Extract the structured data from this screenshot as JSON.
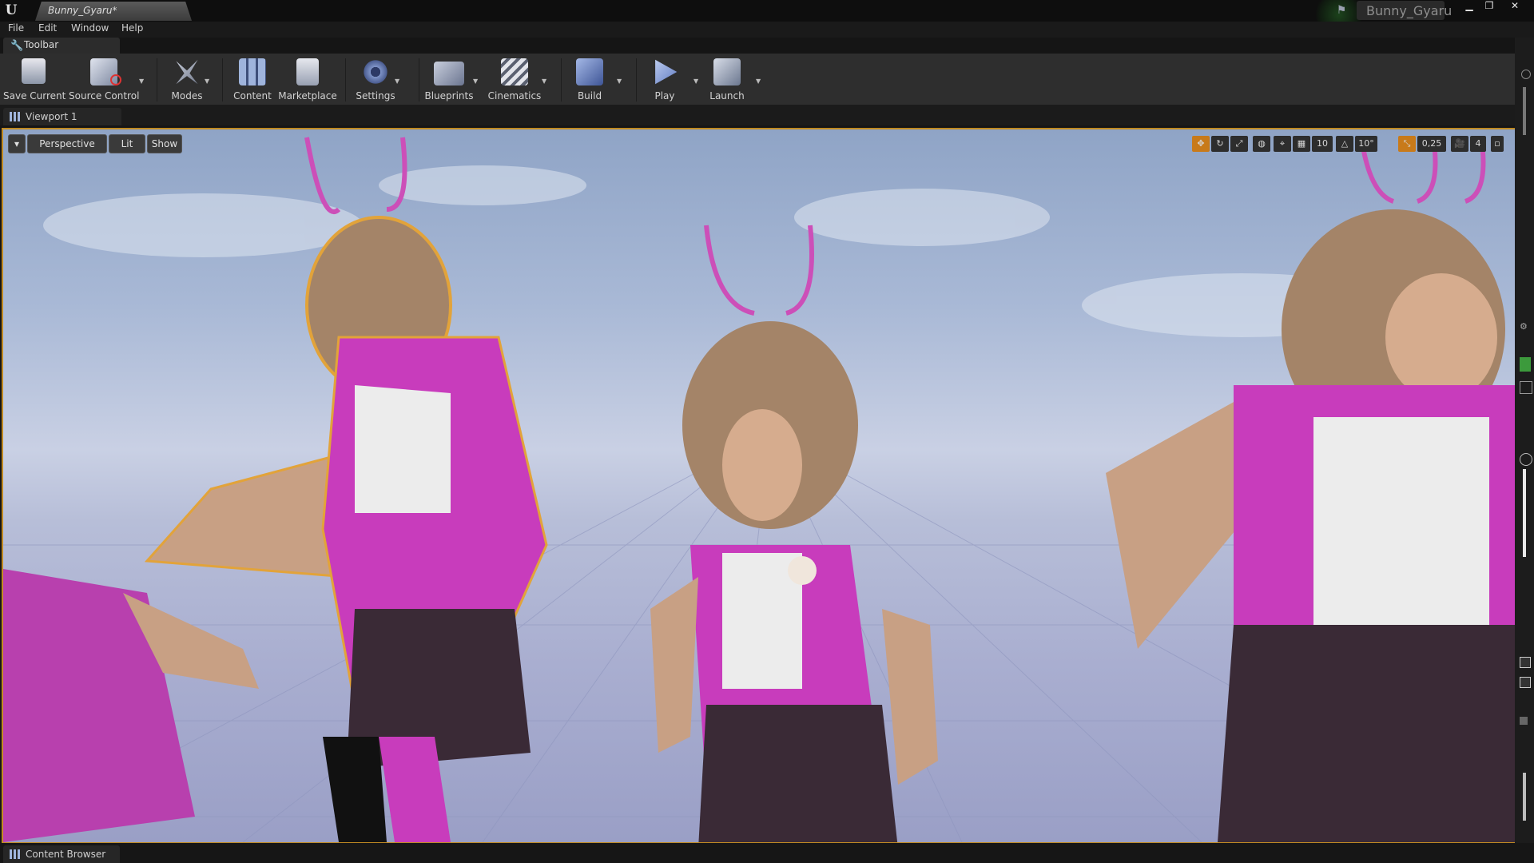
{
  "title_bar": {
    "logo": "U",
    "document_tab": "Bunny_Gyaru*",
    "project_name": "Bunny_Gyaru",
    "icons": [
      "unreal-logo-icon",
      "flag-icon",
      "minimize-icon",
      "restore-icon",
      "close-icon"
    ]
  },
  "menu": {
    "items": [
      "File",
      "Edit",
      "Window",
      "Help"
    ]
  },
  "toolbar_tab": {
    "label": "Toolbar"
  },
  "toolbar": {
    "buttons": [
      {
        "label": "Save Current",
        "icon": "save-icon"
      },
      {
        "label": "Source Control",
        "icon": "source-control-icon"
      },
      {
        "label": "Modes",
        "icon": "modes-icon"
      },
      {
        "label": "Content",
        "icon": "content-icon"
      },
      {
        "label": "Marketplace",
        "icon": "marketplace-icon"
      },
      {
        "label": "Settings",
        "icon": "settings-icon"
      },
      {
        "label": "Blueprints",
        "icon": "blueprints-icon"
      },
      {
        "label": "Cinematics",
        "icon": "cinematics-icon"
      },
      {
        "label": "Build",
        "icon": "build-icon"
      },
      {
        "label": "Play",
        "icon": "play-icon"
      },
      {
        "label": "Launch",
        "icon": "launch-icon"
      }
    ]
  },
  "viewport": {
    "tab_label": "Viewport 1",
    "view_mode": "Perspective",
    "lighting": "Lit",
    "show": "Show",
    "grid_snap": "10",
    "rotation_snap": "10°",
    "scale_snap": "0,25",
    "camera_speed": "4",
    "accent_color": "#c08a22"
  },
  "bottom": {
    "content_browser_label": "Content Browser"
  },
  "colors": {
    "vest_pink": "#c83cbc",
    "sky_blue": "#9fb1d2"
  }
}
